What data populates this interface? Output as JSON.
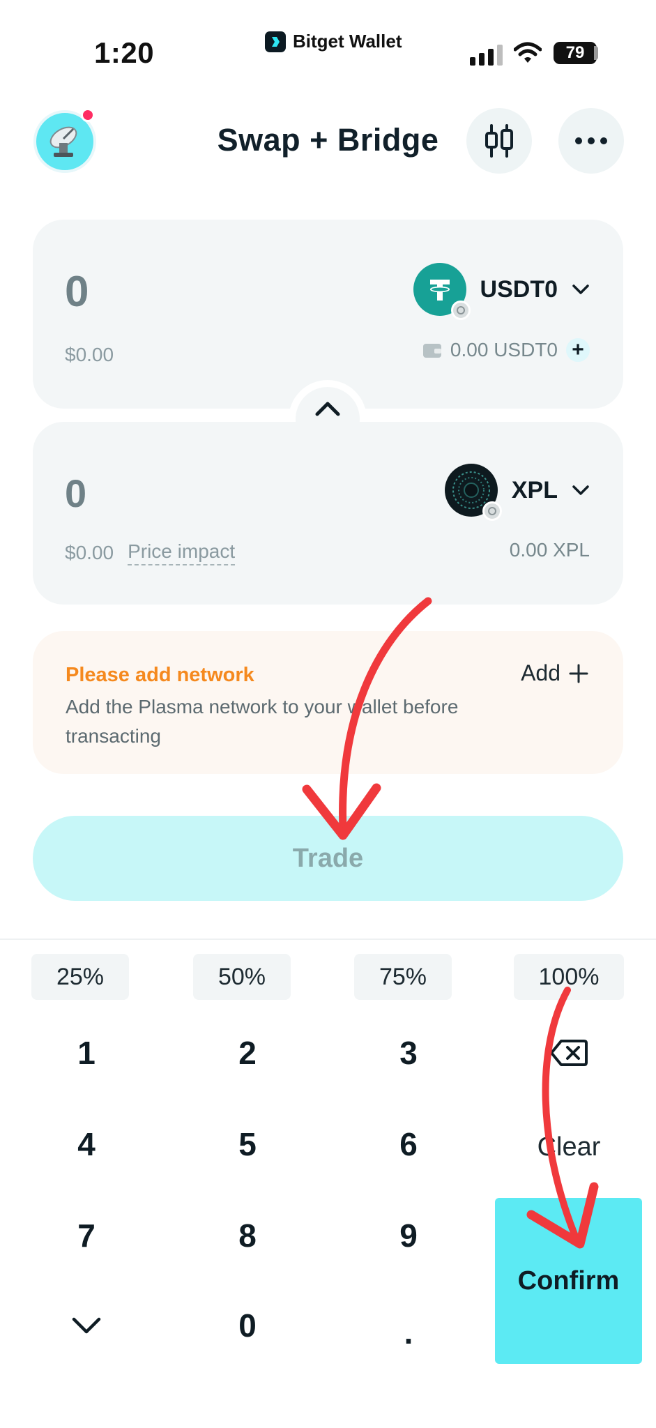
{
  "status_bar": {
    "time": "1:20",
    "center_app": "Bitget Wallet",
    "battery": "79"
  },
  "header": {
    "title": "Swap + Bridge"
  },
  "from": {
    "amount": "0",
    "fiat": "$0.00",
    "token": "USDT0",
    "balance": "0.00 USDT0",
    "token_color": "#17a196"
  },
  "to": {
    "amount": "0",
    "fiat": "$0.00",
    "price_impact_label": "Price impact",
    "token": "XPL",
    "balance": "0.00 XPL",
    "token_color": "#0e1a1f"
  },
  "warning": {
    "title": "Please add network",
    "body": "Add the Plasma network to your wallet before transacting",
    "action": "Add"
  },
  "trade_button": "Trade",
  "percents": [
    "25%",
    "50%",
    "75%",
    "100%"
  ],
  "keypad": {
    "digits": [
      "1",
      "2",
      "3",
      "4",
      "5",
      "6",
      "7",
      "8",
      "9",
      "0",
      "."
    ],
    "clear": "Clear",
    "confirm": "Confirm"
  },
  "colors": {
    "accent": "#5ceaf3",
    "warning": "#f5891e",
    "annotation": "#f0393c"
  }
}
